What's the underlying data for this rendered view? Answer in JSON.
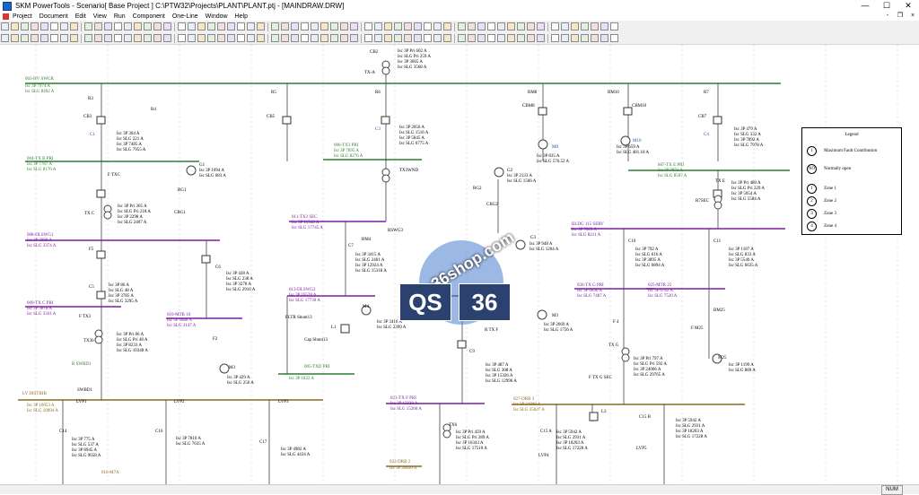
{
  "window": {
    "title": "SKM PowerTools - Scenario[ Base Project ] C:\\PTW32\\Projects\\PLANT\\PLANT.ptj - [MAINDRAW.DRW]",
    "minimize": "—",
    "maximize": "☐",
    "close": "✕"
  },
  "menu": [
    "Project",
    "Document",
    "Edit",
    "View",
    "Run",
    "Component",
    "One-Line",
    "Window",
    "Help"
  ],
  "mdi": {
    "minimize": "-",
    "restore": "❐",
    "close": "×"
  },
  "toolbar1_count": 60,
  "toolbar2_count": 60,
  "legend": {
    "title": "Legend",
    "rows": [
      {
        "sym": "1",
        "text": "Maximum Fault Contribution"
      },
      {
        "sym": "NO",
        "text": "Normally open"
      },
      {
        "sym": "1",
        "text": "Zone 1"
      },
      {
        "sym": "2",
        "text": "Zone 2"
      },
      {
        "sym": "3",
        "text": "Zone 3"
      },
      {
        "sym": "4",
        "text": "Zone 4"
      }
    ]
  },
  "labels": [
    {
      "text": "CB2",
      "cls": "k"
    },
    {
      "text": "TX-A",
      "cls": "k"
    },
    {
      "text": "Isc 3P Pri 602 A",
      "cls": "k"
    },
    {
      "text": "Isc SLG Pri 259 A",
      "cls": "k"
    },
    {
      "text": "Isc 3P 3665 A",
      "cls": "k"
    },
    {
      "text": "Isc SLG 3568 A",
      "cls": "k"
    },
    {
      "text": "003-HV SWGR",
      "cls": "g"
    },
    {
      "text": "Isc 3P 7974 A",
      "cls": "g"
    },
    {
      "text": "Isc SLG 8492 A",
      "cls": "g"
    },
    {
      "text": "R3",
      "cls": "k"
    },
    {
      "text": "R5",
      "cls": "k"
    },
    {
      "text": "R6",
      "cls": "k"
    },
    {
      "text": "RM8",
      "cls": "k"
    },
    {
      "text": "RM10",
      "cls": "k"
    },
    {
      "text": "R7",
      "cls": "k"
    },
    {
      "text": "CB3",
      "cls": "k"
    },
    {
      "text": "CB5",
      "cls": "k"
    },
    {
      "text": "CBM8",
      "cls": "k"
    },
    {
      "text": "CBM10",
      "cls": "k"
    },
    {
      "text": "CB7",
      "cls": "k"
    },
    {
      "text": "R4",
      "cls": "k"
    },
    {
      "text": "C1",
      "cls": "b"
    },
    {
      "text": "C3",
      "cls": "b"
    },
    {
      "text": "C4",
      "cls": "b"
    },
    {
      "text": "Isc 3P 304 A",
      "cls": "k"
    },
    {
      "text": "Isc SLG 221 A",
      "cls": "k"
    },
    {
      "text": "Isc 3P 7485 A",
      "cls": "k"
    },
    {
      "text": "Isc SLG 7955 A",
      "cls": "k"
    },
    {
      "text": "Isc 3P 2056 A",
      "cls": "k"
    },
    {
      "text": "Isc SLG 1516 A",
      "cls": "k"
    },
    {
      "text": "Isc 3P 5845 A",
      "cls": "k"
    },
    {
      "text": "Isc SLG 6775 A",
      "cls": "k"
    },
    {
      "text": "M8",
      "cls": "b"
    },
    {
      "text": "Isc 3P 835 A",
      "cls": "k"
    },
    {
      "text": "Isc SLG 576.52 A",
      "cls": "k"
    },
    {
      "text": "M10",
      "cls": "b"
    },
    {
      "text": "Isc 3P 659 A",
      "cls": "k"
    },
    {
      "text": "Isc SLG 481.18 A",
      "cls": "k"
    },
    {
      "text": "Isc 3P 479 A",
      "cls": "k"
    },
    {
      "text": "Isc SLG 332 A",
      "cls": "k"
    },
    {
      "text": "Isc 3P 7892 A",
      "cls": "k"
    },
    {
      "text": "Isc SLG 7978 A",
      "cls": "k"
    },
    {
      "text": "004-TX B PRI",
      "cls": "g"
    },
    {
      "text": "Isc 3P 7787 A",
      "cls": "g"
    },
    {
      "text": "Isc SLG 8170 A",
      "cls": "g"
    },
    {
      "text": "006-TX3 PRI",
      "cls": "g"
    },
    {
      "text": "Isc 3P 7895 A",
      "cls": "g"
    },
    {
      "text": "Isc SLG 8276 A",
      "cls": "g"
    },
    {
      "text": "007-TX E PRI",
      "cls": "g"
    },
    {
      "text": "Isc 3P 7871 A",
      "cls": "g"
    },
    {
      "text": "Isc SLG 8507 A",
      "cls": "g"
    },
    {
      "text": "G1",
      "cls": "k"
    },
    {
      "text": "Isc 3P 1094 A",
      "cls": "k"
    },
    {
      "text": "Isc SLG 683 A",
      "cls": "k"
    },
    {
      "text": "G2",
      "cls": "k"
    },
    {
      "text": "Isc 3P 2133 A",
      "cls": "k"
    },
    {
      "text": "Isc SLG 1566 A",
      "cls": "k"
    },
    {
      "text": "F TXC",
      "cls": "k"
    },
    {
      "text": "TX3WND",
      "cls": "k"
    },
    {
      "text": "RG1",
      "cls": "k"
    },
    {
      "text": "CBG1",
      "cls": "k"
    },
    {
      "text": "RG2",
      "cls": "k"
    },
    {
      "text": "CBG2",
      "cls": "k"
    },
    {
      "text": "TX C",
      "cls": "k"
    },
    {
      "text": "Isc 3P Pri 305 A",
      "cls": "k"
    },
    {
      "text": "Isc SLG Pri 218 A",
      "cls": "k"
    },
    {
      "text": "Isc 3P 2298 A",
      "cls": "k"
    },
    {
      "text": "Isc SLG 2407 A",
      "cls": "k"
    },
    {
      "text": "TX E",
      "cls": "k"
    },
    {
      "text": "R7SEC",
      "cls": "k"
    },
    {
      "text": "Isc 3P Pri 480 A",
      "cls": "k"
    },
    {
      "text": "Isc SLG Pri 329 A",
      "cls": "k"
    },
    {
      "text": "Isc 3P 5054 A",
      "cls": "k"
    },
    {
      "text": "Isc SLG 5584 A",
      "cls": "k"
    },
    {
      "text": "011-TX3 SEC",
      "cls": "p"
    },
    {
      "text": "Isc 3P 16542 A",
      "cls": "p"
    },
    {
      "text": "Isc SLG 17745 A",
      "cls": "p"
    },
    {
      "text": "008-DLSWG1",
      "cls": "p"
    },
    {
      "text": "Isc 3P 3899 A",
      "cls": "p"
    },
    {
      "text": "Isc SLG 3374 A",
      "cls": "p"
    },
    {
      "text": "BLDG 115 SERV",
      "cls": "p"
    },
    {
      "text": "Isc 3P 7009 A",
      "cls": "p"
    },
    {
      "text": "Isc SLG 8211 A",
      "cls": "p"
    },
    {
      "text": "RSWG3",
      "cls": "k"
    },
    {
      "text": "RM4",
      "cls": "k"
    },
    {
      "text": "C7",
      "cls": "k"
    },
    {
      "text": "G3",
      "cls": "k"
    },
    {
      "text": "Isc 3P 948 A",
      "cls": "k"
    },
    {
      "text": "Isc SLG 1204 A",
      "cls": "k"
    },
    {
      "text": "Isc 3P 3415 A",
      "cls": "k"
    },
    {
      "text": "Isc SLG 2401 A",
      "cls": "k"
    },
    {
      "text": "Isc 3P 12924 A",
      "cls": "k"
    },
    {
      "text": "Isc SLG 15318 A",
      "cls": "k"
    },
    {
      "text": "C10",
      "cls": "k"
    },
    {
      "text": "Isc 3P 792 A",
      "cls": "k"
    },
    {
      "text": "Isc SLG 616 A",
      "cls": "k"
    },
    {
      "text": "Isc 3P 3895 A",
      "cls": "k"
    },
    {
      "text": "Isc SLG 6894 A",
      "cls": "k"
    },
    {
      "text": "C11",
      "cls": "k"
    },
    {
      "text": "Isc 3P 1187 A",
      "cls": "k"
    },
    {
      "text": "Isc SLG 833 A",
      "cls": "k"
    },
    {
      "text": "Isc 3P 5540 A",
      "cls": "k"
    },
    {
      "text": "Isc SLG 6635 A",
      "cls": "k"
    },
    {
      "text": "F5",
      "cls": "k"
    },
    {
      "text": "C6",
      "cls": "k"
    },
    {
      "text": "C5",
      "cls": "k"
    },
    {
      "text": "Isc 3P 428 A",
      "cls": "k"
    },
    {
      "text": "Isc SLG 238 A",
      "cls": "k"
    },
    {
      "text": "Isc 3P 3278 A",
      "cls": "k"
    },
    {
      "text": "Isc SLG 2916 A",
      "cls": "k"
    },
    {
      "text": "Isc 3P 86 A",
      "cls": "k"
    },
    {
      "text": "Isc SLG 48 A",
      "cls": "k"
    },
    {
      "text": "Isc 3P 3785 A",
      "cls": "k"
    },
    {
      "text": "Isc SLG 3295 A",
      "cls": "k"
    },
    {
      "text": "013-DLSWG2",
      "cls": "p"
    },
    {
      "text": "Isc 3P 16528 A",
      "cls": "p"
    },
    {
      "text": "Isc SLG 17730 A",
      "cls": "p"
    },
    {
      "text": "014-TX F PRI",
      "cls": "p"
    },
    {
      "text": "Isc 3P 17055 A",
      "cls": "p"
    },
    {
      "text": "Isc SLG 18001 A",
      "cls": "p"
    },
    {
      "text": "026-TX G PRI",
      "cls": "p"
    },
    {
      "text": "Isc 3P 6690 A",
      "cls": "p"
    },
    {
      "text": "Isc SLG 7487 A",
      "cls": "p"
    },
    {
      "text": "025-MTR 25",
      "cls": "p"
    },
    {
      "text": "Isc 3P 6782 A",
      "cls": "p"
    },
    {
      "text": "Isc SLG 7520 A",
      "cls": "p"
    },
    {
      "text": "009-TX C PRI",
      "cls": "p"
    },
    {
      "text": "Isc 3P 3878 A",
      "cls": "p"
    },
    {
      "text": "Isc SLG 3341 A",
      "cls": "p"
    },
    {
      "text": "010-MTR 10",
      "cls": "p"
    },
    {
      "text": "Isc 3P 3688 A",
      "cls": "p"
    },
    {
      "text": "Isc SLG 3147 A",
      "cls": "p"
    },
    {
      "text": "F TX3",
      "cls": "k"
    },
    {
      "text": "FLTR Shunt13",
      "cls": "k"
    },
    {
      "text": "L1",
      "cls": "k"
    },
    {
      "text": "M4",
      "cls": "k"
    },
    {
      "text": "M3",
      "cls": "k"
    },
    {
      "text": "Cap Shunt13",
      "cls": "k"
    },
    {
      "text": "Isc 3P 3416 A",
      "cls": "k"
    },
    {
      "text": "Isc SLG 2399 A",
      "cls": "k"
    },
    {
      "text": "Isc 3P 2669 A",
      "cls": "k"
    },
    {
      "text": "Isc SLG 1756 A",
      "cls": "k"
    },
    {
      "text": "BM25",
      "cls": "k"
    },
    {
      "text": "F M25",
      "cls": "k"
    },
    {
      "text": "F 4",
      "cls": "k"
    },
    {
      "text": "R TX F",
      "cls": "k"
    },
    {
      "text": "TX G",
      "cls": "k"
    },
    {
      "text": "TX3b",
      "cls": "k"
    },
    {
      "text": "Isc 3P Pri 86 A",
      "cls": "k"
    },
    {
      "text": "Isc SLG Pri 48 A",
      "cls": "k"
    },
    {
      "text": "Isc 3P 8233 A",
      "cls": "k"
    },
    {
      "text": "Isc SLG 10348 A",
      "cls": "k"
    },
    {
      "text": "F2",
      "cls": "k"
    },
    {
      "text": "M3",
      "cls": "k"
    },
    {
      "text": "Isc 3P 429 A",
      "cls": "k"
    },
    {
      "text": "Isc SLG 256 A",
      "cls": "k"
    },
    {
      "text": "C9",
      "cls": "k"
    },
    {
      "text": "Isc 3P 487 A",
      "cls": "k"
    },
    {
      "text": "Isc SLG 308 A",
      "cls": "k"
    },
    {
      "text": "Isc 3P 15326 A",
      "cls": "k"
    },
    {
      "text": "Isc SLG 12996 A",
      "cls": "k"
    },
    {
      "text": "Isc 3P Pri 797 A",
      "cls": "k"
    },
    {
      "text": "Isc SLG Pri 592 A",
      "cls": "k"
    },
    {
      "text": "Isc 3P 24006 A",
      "cls": "k"
    },
    {
      "text": "Isc SLG 29765 A",
      "cls": "k"
    },
    {
      "text": "F TX G SEC",
      "cls": "k"
    },
    {
      "text": "M25",
      "cls": "k"
    },
    {
      "text": "Isc 3P 1199 A",
      "cls": "k"
    },
    {
      "text": "Isc SLG 889 A",
      "cls": "k"
    },
    {
      "text": "B SWBD1",
      "cls": "g"
    },
    {
      "text": "005-TXD PRI",
      "cls": "g"
    },
    {
      "text": "Isc 3P 1022 A",
      "cls": "g"
    },
    {
      "text": "SWBD1",
      "cls": "k"
    },
    {
      "text": "LV DISTRIB",
      "cls": "y"
    },
    {
      "text": "Isc 3P 10053 A",
      "cls": "y"
    },
    {
      "text": "Isc SLG 10094 A",
      "cls": "y"
    },
    {
      "text": "LVP1",
      "cls": "k"
    },
    {
      "text": "LVP2",
      "cls": "k"
    },
    {
      "text": "LVP3",
      "cls": "k"
    },
    {
      "text": "021-TX F PRI",
      "cls": "p"
    },
    {
      "text": "Isc 3P 15938 A",
      "cls": "p"
    },
    {
      "text": "Isc SLG 15260 A",
      "cls": "p"
    },
    {
      "text": "027-DRB 3",
      "cls": "y"
    },
    {
      "text": "Isc 3P 31889 A",
      "cls": "y"
    },
    {
      "text": "Isc SLG 35627 A",
      "cls": "y"
    },
    {
      "text": "L3",
      "cls": "k"
    },
    {
      "text": "C14",
      "cls": "k"
    },
    {
      "text": "C16",
      "cls": "k"
    },
    {
      "text": "C17",
      "cls": "k"
    },
    {
      "text": "Isc 3P 775 A",
      "cls": "k"
    },
    {
      "text": "Isc SLG 537 A",
      "cls": "k"
    },
    {
      "text": "Isc 3P 8945 A",
      "cls": "k"
    },
    {
      "text": "Isc SLG 9658 A",
      "cls": "k"
    },
    {
      "text": "Isc 3P 7810 A",
      "cls": "k"
    },
    {
      "text": "Isc SLG 7635 A",
      "cls": "k"
    },
    {
      "text": "Isc 3P 4982 A",
      "cls": "k"
    },
    {
      "text": "Isc SLG 4434 A",
      "cls": "k"
    },
    {
      "text": "TX6",
      "cls": "k"
    },
    {
      "text": "Isc 3P Pri 459 A",
      "cls": "k"
    },
    {
      "text": "Isc SLG Pri 289 A",
      "cls": "k"
    },
    {
      "text": "Isc 3P 16343 A",
      "cls": "k"
    },
    {
      "text": "Isc SLG 17510 A",
      "cls": "k"
    },
    {
      "text": "C15 A",
      "cls": "k"
    },
    {
      "text": "Isc 3P 5942 A",
      "cls": "k"
    },
    {
      "text": "Isc SLG 2931 A",
      "cls": "k"
    },
    {
      "text": "Isc 3P 18203 A",
      "cls": "k"
    },
    {
      "text": "Isc SLG 17228 A",
      "cls": "k"
    },
    {
      "text": "C15 B",
      "cls": "k"
    },
    {
      "text": "Isc 3P 5942 A",
      "cls": "k"
    },
    {
      "text": "Isc SLG 2931 A",
      "cls": "k"
    },
    {
      "text": "Isc 3P 18203 A",
      "cls": "k"
    },
    {
      "text": "Isc SLG 17228 A",
      "cls": "k"
    },
    {
      "text": "LVP4",
      "cls": "k"
    },
    {
      "text": "LVP5",
      "cls": "k"
    },
    {
      "text": "022-DRB 2",
      "cls": "y"
    },
    {
      "text": "Isc 3P 20899 A",
      "cls": "y"
    },
    {
      "text": "016-M7A",
      "cls": "y"
    }
  ],
  "watermark": {
    "site": "qs36shop.com",
    "left": "QS",
    "right": "36"
  },
  "status": {
    "num": "NUM"
  }
}
